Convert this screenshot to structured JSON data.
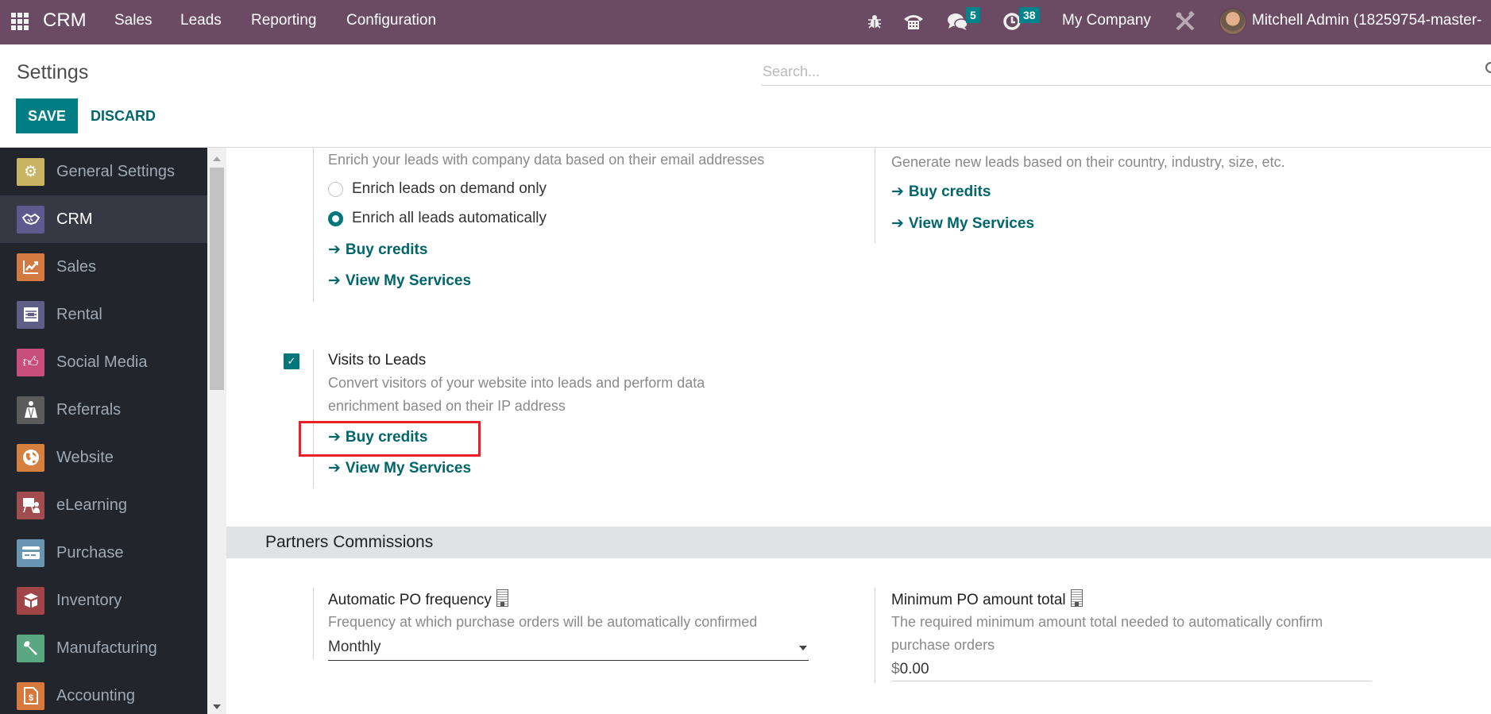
{
  "topbar": {
    "app_name": "CRM",
    "menu": [
      "Sales",
      "Leads",
      "Reporting",
      "Configuration"
    ],
    "icons": {
      "apps": "apps-grid-icon",
      "debug": "bug-icon",
      "voip": "phone-icon",
      "messages": "chat-icon",
      "activities": "clock-icon",
      "settings": "tools-icon"
    },
    "messages_count": "5",
    "activities_count": "38",
    "company": "My Company",
    "user": "Mitchell Admin (18259754-master-"
  },
  "control_panel": {
    "title": "Settings",
    "search_placeholder": "Search...",
    "save_label": "SAVE",
    "discard_label": "DISCARD"
  },
  "sidebar": {
    "items": [
      {
        "label": "General Settings",
        "icon": "gear-icon",
        "color": "#c8b463",
        "active": false
      },
      {
        "label": "CRM",
        "icon": "handshake-icon",
        "color": "#5f5a8e",
        "active": true
      },
      {
        "label": "Sales",
        "icon": "chart-up-icon",
        "color": "#d37a43",
        "active": false
      },
      {
        "label": "Rental",
        "icon": "rental-icon",
        "color": "#5e5e86",
        "active": false
      },
      {
        "label": "Social Media",
        "icon": "thumbs-up-icon",
        "color": "#c84f7c",
        "active": false
      },
      {
        "label": "Referrals",
        "icon": "referral-icon",
        "color": "#5b5b5b",
        "active": false
      },
      {
        "label": "Website",
        "icon": "globe-icon",
        "color": "#d5803f",
        "active": false
      },
      {
        "label": "eLearning",
        "icon": "presentation-icon",
        "color": "#a24c50",
        "active": false
      },
      {
        "label": "Purchase",
        "icon": "credit-card-icon",
        "color": "#6a96b4",
        "active": false
      },
      {
        "label": "Inventory",
        "icon": "box-icon",
        "color": "#a04448",
        "active": false
      },
      {
        "label": "Manufacturing",
        "icon": "wrench-icon",
        "color": "#5aa882",
        "active": false
      },
      {
        "label": "Accounting",
        "icon": "invoice-icon",
        "color": "#d7783d",
        "active": false
      }
    ]
  },
  "main": {
    "lead_enrichment": {
      "description": "Enrich your leads with company data based on their email addresses",
      "options": [
        {
          "label": "Enrich leads on demand only",
          "selected": false
        },
        {
          "label": "Enrich all leads automatically",
          "selected": true
        }
      ],
      "buy_credits": "Buy credits",
      "view_services": "View My Services"
    },
    "lead_generation": {
      "description": "Generate new leads based on their country, industry, size, etc.",
      "buy_credits": "Buy credits",
      "view_services": "View My Services"
    },
    "visits_to_leads": {
      "checked": true,
      "title": "Visits to Leads",
      "description_line1": "Convert visitors of your website into leads and perform data",
      "description_line2": "enrichment based on their IP address",
      "buy_credits": "Buy credits",
      "view_services": "View My Services",
      "highlighted": "Buy credits"
    },
    "partners_commissions": {
      "section_title": "Partners Commissions",
      "po_frequency": {
        "title": "Automatic PO frequency",
        "description": "Frequency at which purchase orders will be automatically confirmed",
        "value": "Monthly"
      },
      "min_po_amount": {
        "title": "Minimum PO amount total",
        "description_line1": "The required minimum amount total needed to automatically confirm",
        "description_line2": "purchase orders",
        "currency": "$",
        "value": "0.00"
      }
    }
  },
  "colors": {
    "topbar": "#6b4a64",
    "primary": "#017e84",
    "link": "#01666b",
    "sidebar": "#22252b",
    "highlight_box": "#e8202a",
    "badge": "#00838a"
  }
}
